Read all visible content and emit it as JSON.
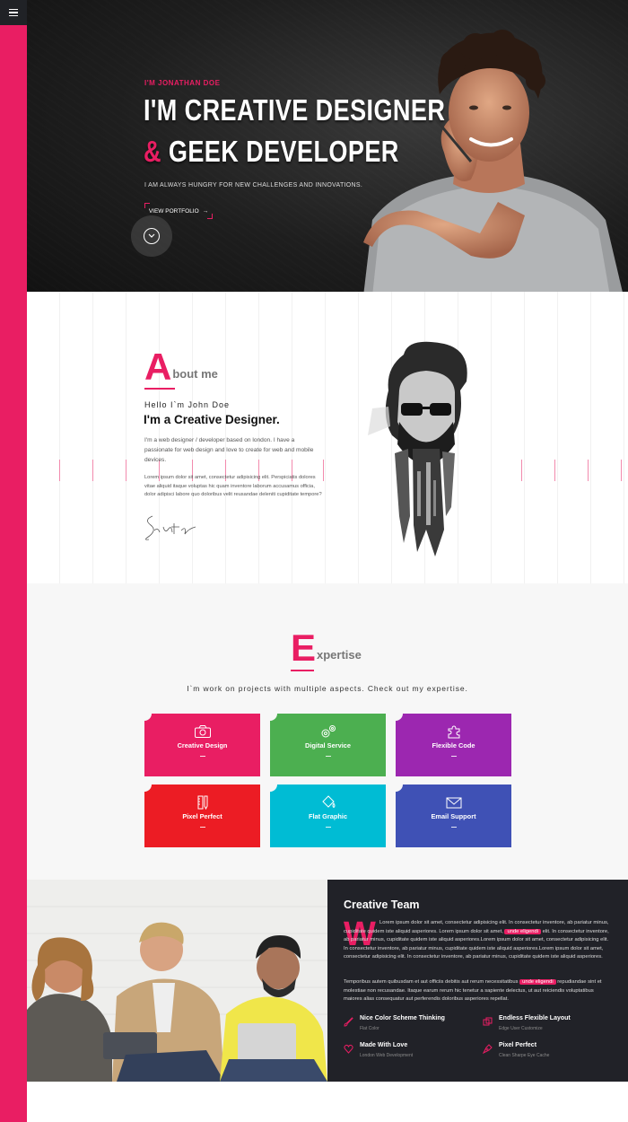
{
  "hero": {
    "kicker": "I'M JONATHAN DOE",
    "line1": "I'M CREATIVE DESIGNER",
    "line2_amp": "&",
    "line2_rest": " GEEK DEVELOPER",
    "subtitle": "I AM ALWAYS HUNGRY FOR NEW CHALLENGES AND INNOVATIONS.",
    "portfolio_label": "VIEW PORTFOLIO",
    "portfolio_arrow": "→"
  },
  "about": {
    "letter": "A",
    "heading_rest": "bout me",
    "hello": "Hello I`m John Doe",
    "title": "I'm a Creative Designer.",
    "p1": "I'm a web designer / developer based on london. I have a passionate for web design and love to create for web and mobile devices.",
    "p2": "Lorem ipsum dolor sit amet, consectetur adipisicing elit. Perspiciatis dolores vitae aliquid itaque voluptas hic quam inventore laborum accusamus officia, dolor adipisci labore quo doloribus velit reusandae deleniti cupiditate tempore?"
  },
  "expertise": {
    "letter": "E",
    "heading_rest": "xpertise",
    "lead": "I`m work on projects with multiple aspects. Check out my expertise.",
    "cards": [
      {
        "label": "Creative Design",
        "color": "#e91e63",
        "icon": "camera-icon"
      },
      {
        "label": "Digital Service",
        "color": "#4caf50",
        "icon": "gears-icon"
      },
      {
        "label": "Flexible Code",
        "color": "#9c27b0",
        "icon": "puzzle-icon"
      },
      {
        "label": "Pixel Perfect",
        "color": "#ec1c24",
        "icon": "pencil-ruler-icon"
      },
      {
        "label": "Flat Graphic",
        "color": "#00bcd4",
        "icon": "paint-bucket-icon"
      },
      {
        "label": "Email Support",
        "color": "#3f51b5",
        "icon": "envelope-icon"
      }
    ]
  },
  "team": {
    "title": "Creative Team",
    "dropcap": "W",
    "p1_a": "Lorem ipsum dolor sit amet, consectetur adipisicing elit. In consectetur inventore, ab pariatur minus, cupiditate quidem iste aliquid asperiores. Lorem ipsum dolor sit amet, ",
    "p1_hl": "unde eligendi",
    "p1_b": " elit. In consectetur inventore, ab pariatur minus, cupiditate quidem iste aliquid asperiores.Lorem ipsum dolor sit amet, consectetur adipisicing elit. In consectetur inventore, ab pariatur minus, cupiditate quidem iste aliquid asperiores.Lorem ipsum dolor sit amet, consectetur adipisicing elit. In consectetur inventore, ab pariatur minus, cupiditate quidem iste aliquid asperiores.",
    "p2_a": "Temporibus autem quibusdam et aut officiis debitis aut rerum necessitatibus ",
    "p2_hl": "unde eligendi",
    "p2_b": " repudiandae sint et molestiae non recusandae. Itaque earum rerum hic tenetur a sapiente delectus, ut aut reiciendis voluptatibus maiores alias consequatur aut perferendis doloribus asperiores repellat.",
    "features": [
      {
        "title": "Nice Color Scheme Thinking",
        "sub": "Flat Color",
        "icon": "brush-icon"
      },
      {
        "title": "Endless Flexible Layout",
        "sub": "Edge User Customize",
        "icon": "layers-icon"
      },
      {
        "title": "Made With Love",
        "sub": "London Web Development",
        "icon": "heart-icon"
      },
      {
        "title": "Pixel Perfect",
        "sub": "Clean Sharpe Eye Cache",
        "icon": "pen-tool-icon"
      }
    ]
  },
  "colors": {
    "accent": "#e91e63",
    "dark": "#212228"
  }
}
